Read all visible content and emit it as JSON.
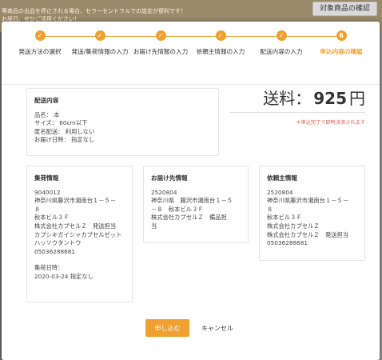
{
  "background": {
    "banner_line1": "等商品の出品を停止される場合、セラーセントラルでの設定が便利です！",
    "banner_line2": "お届日、ぜひご活用ください！",
    "check_button": "対象商品の確認"
  },
  "stepper": {
    "steps": [
      {
        "num": "✓",
        "label": "発送方法の選択"
      },
      {
        "num": "✓",
        "label": "発送/集荷情報の入力"
      },
      {
        "num": "✓",
        "label": "お届け先情報の入力"
      },
      {
        "num": "✓",
        "label": "依頼主情報の入力"
      },
      {
        "num": "✓",
        "label": "配送内容の入力"
      },
      {
        "num": "6",
        "label": "申込内容の確認"
      }
    ],
    "accent": "#f0a030"
  },
  "content": {
    "title": "配送内容",
    "lines": [
      "品名： 本",
      "サイズ： 60cm以下",
      "匿名配送： 利用しない",
      "お届け日時： 指定なし"
    ]
  },
  "fee": {
    "label": "送料：",
    "amount": "925",
    "unit": "円",
    "note": "＊申込完了で即時決済されます"
  },
  "pickup": {
    "title": "集荷情報",
    "lines": [
      "9040012",
      "神奈川県藤沢市湘南台１－５－",
      "８",
      "秋本ビル３Ｆ",
      "株式会社カプセルＺ　発送担当",
      "カプシキガイシャカプセルゼット",
      "ハッソウタントウ",
      "05036288681"
    ],
    "date_label": "集荷日時：",
    "date_value": "2020-03-24 指定なし"
  },
  "destination": {
    "title": "お届け先情報",
    "lines": [
      "2520804",
      "神奈川県　藤沢市湘南台１－５",
      "－８　秋本ビル３Ｆ",
      "株式会社カプセルＺ　備品担",
      "当"
    ]
  },
  "requester": {
    "title": "依頼主情報",
    "lines": [
      "2520804",
      "神奈川県藤沢市湘南台１－５－",
      "８",
      "秋本ビル３Ｆ",
      "株式会社カプセルＺ",
      "株式会社カプセルＺ　発送担当",
      "05036288681"
    ]
  },
  "actions": {
    "apply": "申し込む",
    "cancel": "キャンセル"
  }
}
